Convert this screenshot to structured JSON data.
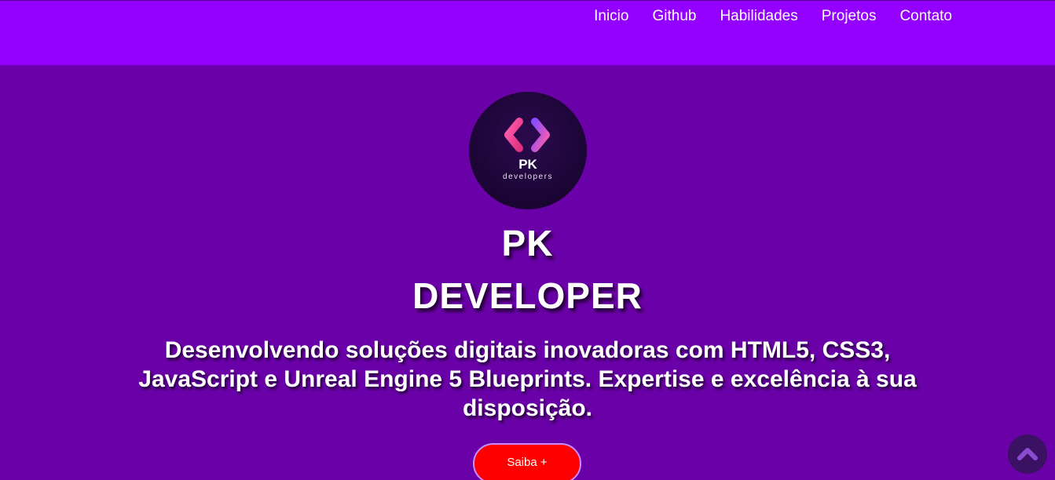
{
  "nav": {
    "items": [
      {
        "label": "Inicio"
      },
      {
        "label": "Github"
      },
      {
        "label": "Habilidades"
      },
      {
        "label": "Projetos"
      },
      {
        "label": "Contato"
      }
    ]
  },
  "logo": {
    "brand": "PK",
    "subtitle": "developers",
    "icon": "code-brackets-icon"
  },
  "hero": {
    "title_line1": "PK",
    "title_line2": "DEVELOPER",
    "description": "Desenvolvendo soluções digitais inovadoras com HTML5, CSS3, JavaScript e Unreal Engine 5 Blueprints. Expertise e excelência à sua disposição.",
    "cta_label": "Saiba +"
  },
  "scroll_top": {
    "icon": "chevron-up-icon"
  },
  "colors": {
    "topbar": "#9400ff",
    "background": "#6a00a8",
    "cta": "#ff0000",
    "logo_bg": "#1a0533",
    "logo_accent_pink": "#ff4fa0",
    "logo_accent_purple": "#7a3cff"
  }
}
